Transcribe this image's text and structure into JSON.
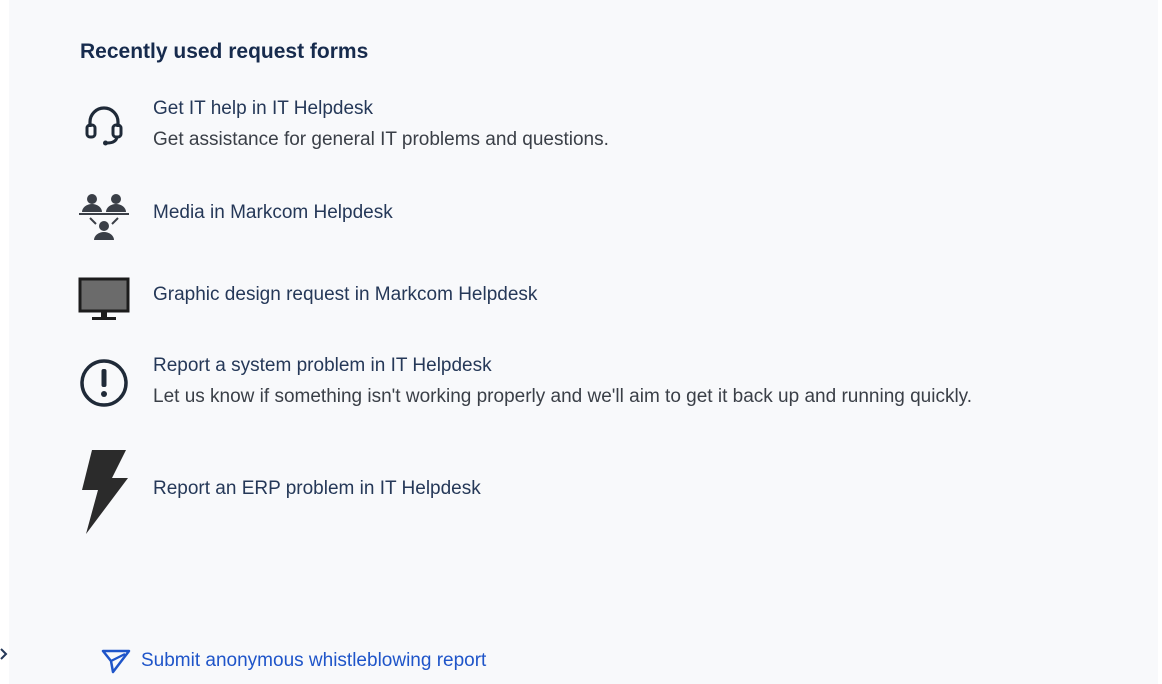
{
  "section": {
    "heading": "Recently used request forms"
  },
  "forms": [
    {
      "icon": "headset-icon",
      "title": "Get IT help in IT Helpdesk",
      "description": "Get assistance for general IT problems and questions."
    },
    {
      "icon": "people-network-icon",
      "title": "Media in Markcom Helpdesk",
      "description": ""
    },
    {
      "icon": "monitor-icon",
      "title": "Graphic design request in Markcom Helpdesk",
      "description": ""
    },
    {
      "icon": "exclamation-circle-icon",
      "title": "Report a system problem in IT Helpdesk",
      "description": "Let us know if something isn't working properly and we'll aim to get it back up and running quickly."
    },
    {
      "icon": "lightning-bolt-icon",
      "title": "Report an ERP problem in IT Helpdesk",
      "description": ""
    }
  ],
  "footer": {
    "icon": "send-icon",
    "whistleblowing_label": "Submit anonymous whistleblowing report",
    "link_color": "#1f55c9"
  }
}
